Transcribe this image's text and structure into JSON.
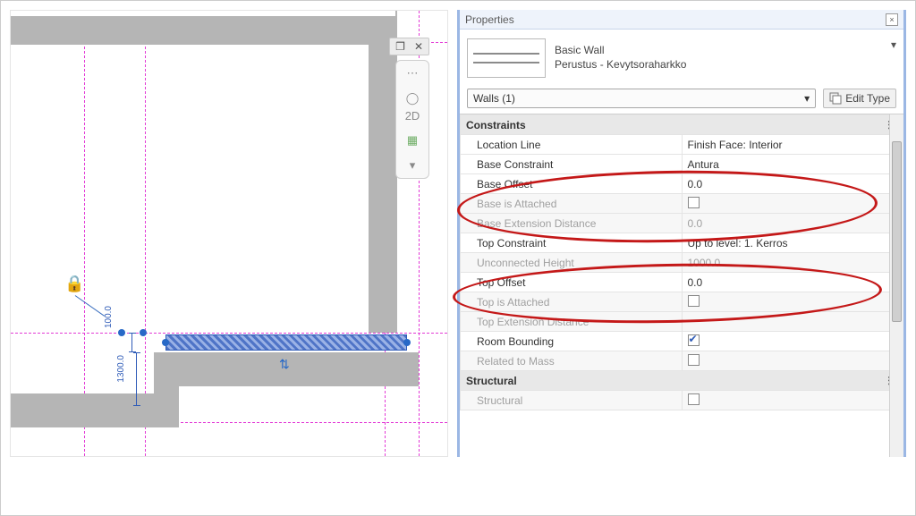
{
  "canvas": {
    "dims": {
      "d1": "100.0",
      "d2": "1300.0"
    },
    "viewcube_label": "2D"
  },
  "properties": {
    "title": "Properties",
    "type_selector": {
      "family": "Basic Wall",
      "type": "Perustus - Kevytsoraharkko"
    },
    "instance_selector": "Walls (1)",
    "edit_type": "Edit Type",
    "groups": {
      "constraints": {
        "label": "Constraints",
        "rows": [
          {
            "k": "Location Line",
            "v": "Finish Face: Interior",
            "enabled": true,
            "check": null
          },
          {
            "k": "Base Constraint",
            "v": "Antura",
            "enabled": true,
            "check": null
          },
          {
            "k": "Base Offset",
            "v": "0.0",
            "enabled": true,
            "check": null
          },
          {
            "k": "Base is Attached",
            "v": "",
            "enabled": false,
            "check": false
          },
          {
            "k": "Base Extension Distance",
            "v": "0.0",
            "enabled": false,
            "check": null
          },
          {
            "k": "Top Constraint",
            "v": "Up to level: 1. Kerros",
            "enabled": true,
            "check": null
          },
          {
            "k": "Unconnected Height",
            "v": "1000.0",
            "enabled": false,
            "check": null
          },
          {
            "k": "Top Offset",
            "v": "0.0",
            "enabled": true,
            "check": null
          },
          {
            "k": "Top is Attached",
            "v": "",
            "enabled": false,
            "check": false
          },
          {
            "k": "Top Extension Distance",
            "v": "",
            "enabled": false,
            "check": null
          },
          {
            "k": "Room Bounding",
            "v": "",
            "enabled": true,
            "check": true
          },
          {
            "k": "Related to Mass",
            "v": "",
            "enabled": false,
            "check": false
          }
        ]
      },
      "structural": {
        "label": "Structural",
        "rows": [
          {
            "k": "Structural",
            "v": "",
            "enabled": false,
            "check": false
          }
        ]
      }
    }
  }
}
